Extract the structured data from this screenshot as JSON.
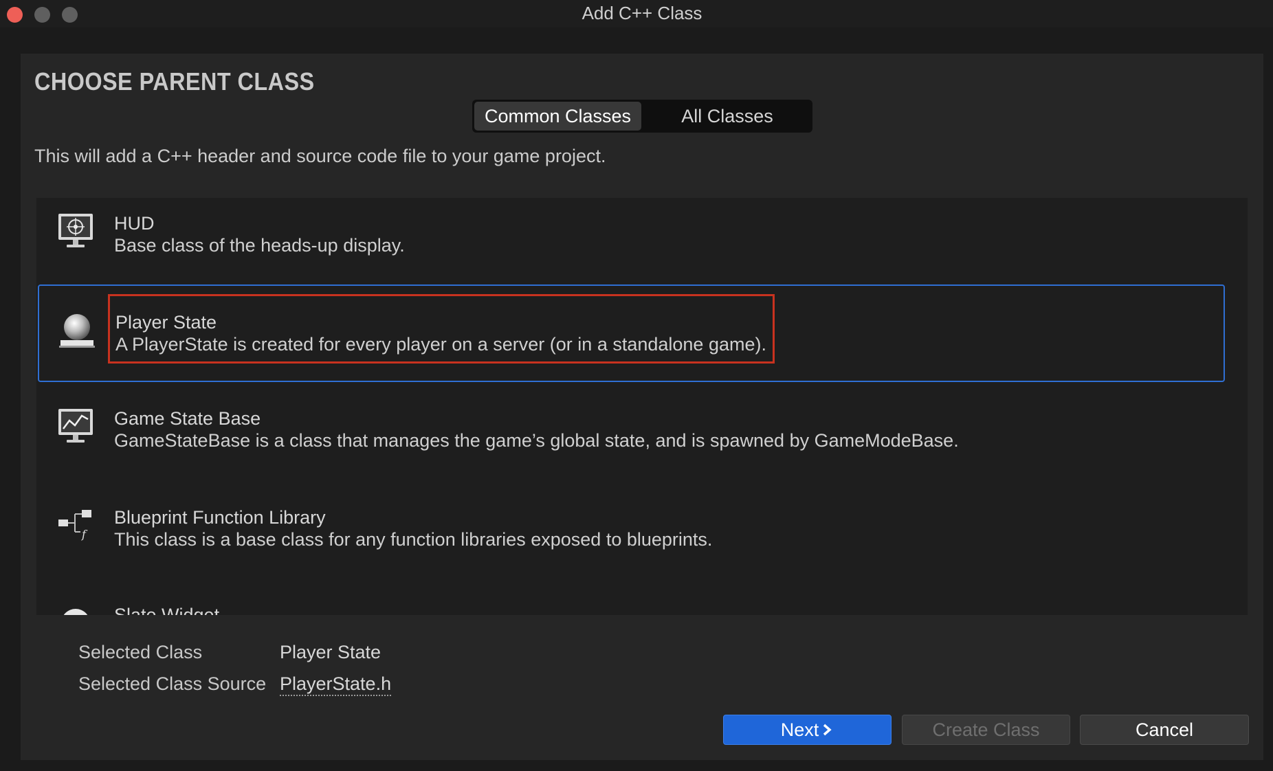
{
  "window": {
    "title": "Add C++ Class"
  },
  "header": {
    "heading": "CHOOSE PARENT CLASS",
    "description": "This will add a C++ header and source code file to your game project."
  },
  "tabs": [
    {
      "label": "Common Classes",
      "active": true
    },
    {
      "label": "All Classes",
      "active": false
    }
  ],
  "classes": [
    {
      "name": "HUD",
      "description": "Base class of the heads-up display.",
      "icon": "hud-monitor-icon"
    },
    {
      "name": "Player State",
      "description": "A PlayerState is created for every player on a server (or in a standalone game).",
      "icon": "player-sphere-icon",
      "selected": true
    },
    {
      "name": "Game State Base",
      "description": "GameStateBase is a class that manages the game’s global state, and is spawned by GameModeBase.",
      "icon": "graph-monitor-icon"
    },
    {
      "name": "Blueprint Function Library",
      "description": "This class is a base class for any function libraries exposed to blueprints.",
      "icon": "function-node-icon"
    },
    {
      "name": "Slate Widget",
      "description": "",
      "icon": "widget-icon"
    }
  ],
  "selection": {
    "class_label": "Selected Class",
    "class_value": "Player State",
    "source_label": "Selected Class Source",
    "source_value": "PlayerState.h"
  },
  "buttons": {
    "next": "Next",
    "create": "Create Class",
    "cancel": "Cancel"
  },
  "colors": {
    "accent": "#1f66d9",
    "selection_border": "#2f6fd3",
    "annotation": "#c8321f"
  }
}
